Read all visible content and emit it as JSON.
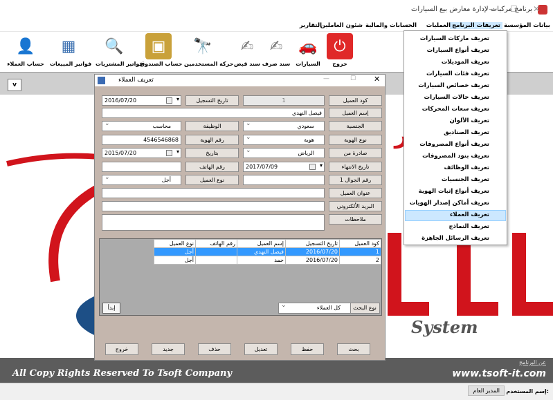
{
  "window": {
    "title": "برنامج مركبات لإدارة معارض بيع السيارات"
  },
  "menubar": [
    "بيانات المؤسسة",
    "تعريفات البرنامج",
    "العمليات",
    "الحسابات والمالية",
    "شئون العاملين",
    "التقارير"
  ],
  "toolbar": [
    {
      "label": "خروج",
      "icon": "power-icon"
    },
    {
      "label": "السيارات",
      "icon": "car-icon"
    },
    {
      "label": "سند صرف",
      "icon": "payment-voucher-icon"
    },
    {
      "label": "سند قبض",
      "icon": "receipt-voucher-icon"
    },
    {
      "label": "حركة المستخدمين",
      "icon": "binoculars-icon"
    },
    {
      "label": "حساب الصندوق",
      "icon": "safe-icon"
    },
    {
      "label": "فواتير المشتريات",
      "icon": "magnifier-icon"
    },
    {
      "label": "فواتير المبيعات",
      "icon": "invoice-icon"
    },
    {
      "label": "حساب العملاء",
      "icon": "user-icon"
    }
  ],
  "strip": {
    "dropdown": "v"
  },
  "dropdown_menu": {
    "items": [
      "تعريف ماركات السيارات",
      "تعريف أنواع السيارات",
      "تعريف الموديلات",
      "تعريف فئات السيارات",
      "تعريف خصائص السيارات",
      "تعريف حالات السيارات",
      "تعريف سعات المحركات",
      "تعريف الألوان",
      "تعريف الصناديق",
      "تعريف أنواع المصروفات",
      "تعريف بنود المصروفات",
      "تعريف الوظائف",
      "تعريف الجنسيات",
      "تعريف أنواع إثبات الهوية",
      "تعريف أماكن إصدار الهويات",
      "تعريف العملاء",
      "تعريف النماذج",
      "تعريف الرسائل الجاهزة"
    ],
    "selected": "تعريف العملاء"
  },
  "dialog": {
    "title": "تعريف العملاء",
    "labels": {
      "code": "كود العميل",
      "name": "إسم العميل",
      "nationality": "الجنسية",
      "id_type": "نوع الهوية",
      "issued_from": "صادرة من",
      "expiry": "تاريخ الانتهاء",
      "mobile": "رقم الجوال 1",
      "address": "عنوان العميل",
      "email": "البريد الألكتروني",
      "notes": "ملاحظات",
      "reg_date": "تاريخ التسجيل",
      "job": "الوظيفة",
      "id_number": "رقم الهوية",
      "issue_date": "بتاريخ",
      "phone": "رقم الهاتف",
      "client_type": "نوع العميل"
    },
    "values": {
      "code": "1",
      "name": "فيصل النهدي",
      "nationality": "سعودي",
      "id_type": "هوية",
      "issued_from": "الرياض",
      "expiry": "2017/07/09",
      "reg_date": "2016/07/20",
      "job": "محاسب",
      "id_number": "4546546868",
      "issue_date": "2015/07/20",
      "client_type": "أجل"
    },
    "grid": {
      "headers": [
        "كود العميل",
        "تاريخ التسجيل",
        "إسم العميل",
        "رقم الهاتف",
        "نوع العميل"
      ],
      "rows": [
        [
          "1",
          "2016/07/20",
          "فيصل النهدي",
          "",
          "أجل"
        ],
        [
          "2",
          "2016/07/20",
          "حمد",
          "",
          "أجل"
        ]
      ]
    },
    "search": {
      "type_label": "نوع البحث",
      "type_value": "كل العملاء",
      "start": "إبدأ"
    },
    "buttons": [
      "بحث",
      "حفظ",
      "تعديل",
      "حذف",
      "جديد",
      "خروج"
    ]
  },
  "footer": {
    "copyright": "All Copy Rights Reserved To Tsoft Company",
    "website": "www.tsoft-it.com",
    "about": "عن البرنامج"
  },
  "status": {
    "user_label": "إسم المستخدم:",
    "user_value": "المدير العام"
  }
}
